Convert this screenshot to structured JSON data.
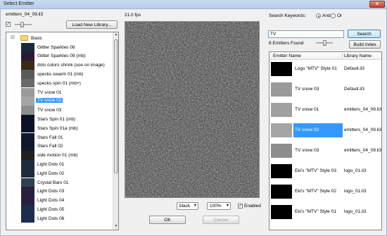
{
  "window": {
    "title": "Select Emitter",
    "close_label": "x"
  },
  "library": {
    "name": "emitters_04_09.il3",
    "show_thumbnails": true,
    "load_button": "Load New Library..."
  },
  "tree": {
    "folder": {
      "label": "Basic",
      "expander": "⊟"
    },
    "selected_index": 5,
    "items": [
      {
        "label": "Glitter Sparkles 08",
        "thumb": "#1a2a3a"
      },
      {
        "label": "Glitter Sparkles 09 (mb)",
        "thumb": "#2a1a3a"
      },
      {
        "label": "dots colors shrink (use on image)",
        "thumb": "#3a2a1a"
      },
      {
        "label": "specks swarm 01 (mb)",
        "thumb": "#5a5a5a"
      },
      {
        "label": "specks spin 01 (mb+)",
        "thumb": "#6a6a6a"
      },
      {
        "label": "TV snow 01",
        "thumb": "#9a9a9a"
      },
      {
        "label": "TV snow 02",
        "thumb": "#a5a5a5"
      },
      {
        "label": "TV snow 03",
        "thumb": "#8d8d8d"
      },
      {
        "label": "Stars Spin 01 (mb)",
        "thumb": "#0a1028"
      },
      {
        "label": "Stars Spin 01a (mb)",
        "thumb": "#0a1028"
      },
      {
        "label": "Stars Fall 01",
        "thumb": "#101830"
      },
      {
        "label": "Stars Fall 02",
        "thumb": "#101830"
      },
      {
        "label": "side motion 01 (mb)",
        "thumb": "#202020"
      },
      {
        "label": "Light Dots 01",
        "thumb": "#1e2a3e"
      },
      {
        "label": "Light Dots 02",
        "thumb": "#1e2a3e"
      },
      {
        "label": "Crystal Bars 01",
        "thumb": "#304050"
      },
      {
        "label": "Light Dots 03",
        "thumb": "#2a1e3e"
      },
      {
        "label": "Light Dots 04",
        "thumb": "#2a1e3e"
      },
      {
        "label": "Light Dots 05",
        "thumb": "#1a2e4e"
      },
      {
        "label": "Light Dots 06",
        "thumb": "#1a2e4e"
      }
    ]
  },
  "preview": {
    "fps": "21.0 fps",
    "background": "black",
    "zoom": "100%",
    "enabled_label": "Enabled",
    "enabled": true
  },
  "search": {
    "keywords_label": "Search Keywords:",
    "mode_and": "And",
    "mode_or": "Or",
    "mode": "And",
    "query": "TV",
    "search_button": "Search",
    "found": "8 Emitters Found",
    "build_index_button": "Build Index"
  },
  "results": {
    "columns": [
      "Emitter Name",
      "Library Name"
    ],
    "selected_index": 3,
    "rows": [
      {
        "name": "Logo \"MTV\" Style 01",
        "library": "Default.il3",
        "thumb": "#000000"
      },
      {
        "name": "TV snow 03",
        "library": "Default.il3",
        "thumb": "#9a9a9a"
      },
      {
        "name": "TV snow 01",
        "library": "emitters_04_09.il3",
        "thumb": "#a0a0a0"
      },
      {
        "name": "TV snow 02",
        "library": "emitters_04_09.il3",
        "thumb": "#a5a5a5"
      },
      {
        "name": "TV snow 03",
        "library": "emitters_04_09.il3",
        "thumb": "#8d8d8d"
      },
      {
        "name": "Eki's \"MTV\" Style 03",
        "library": "logo_01.il3",
        "thumb": "#000000"
      },
      {
        "name": "Eki's \"MTV\" Style 02",
        "library": "logo_01.il3",
        "thumb": "#000000"
      },
      {
        "name": "Eki's \"MTV\" Style 01",
        "library": "logo_01.il3",
        "thumb": "#000000"
      }
    ]
  },
  "footer": {
    "ok": "OK",
    "cancel": "Cancel"
  },
  "colors": {
    "selection": "#3399ff",
    "window_bg": "#f0f0f0"
  }
}
